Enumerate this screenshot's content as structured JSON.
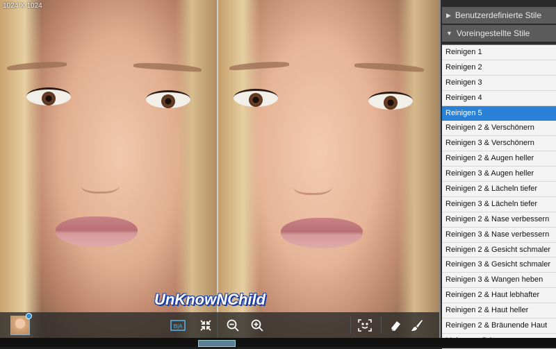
{
  "viewer": {
    "size_label": "1024 X 1024",
    "watermark": "UnKnowNChild"
  },
  "toolbar": {
    "buttons": [
      {
        "name": "before-after-button",
        "icon": "before-after-icon"
      },
      {
        "name": "fit-screen-button",
        "icon": "collapse-arrows-icon"
      },
      {
        "name": "zoom-out-button",
        "icon": "zoom-out-icon"
      },
      {
        "name": "zoom-in-button",
        "icon": "zoom-in-icon"
      },
      {
        "name": "face-detect-button",
        "icon": "smiley-face-icon"
      },
      {
        "name": "eraser-button",
        "icon": "eraser-icon"
      },
      {
        "name": "brush-button",
        "icon": "brush-icon"
      }
    ]
  },
  "panel": {
    "section_custom": "Benutzerdefinierte Stile",
    "section_preset": "Voreingestellte Stile",
    "selected_index": 4,
    "items": [
      "Reinigen 1",
      "Reinigen 2",
      "Reinigen 3",
      "Reinigen 4",
      "Reinigen 5",
      "Reinigen 2 & Verschönern",
      "Reinigen 3 & Verschönern",
      "Reinigen 2 & Augen heller",
      "Reinigen 3 & Augen heller",
      "Reinigen 2 & Lächeln tiefer",
      "Reinigen 3 & Lächeln tiefer",
      "Reinigen 2 & Nase verbessern",
      "Reinigen 3 & Nase verbessern",
      "Reinigen 2 & Gesicht schmaler",
      "Reinigen 3 & Gesicht schmaler",
      "Reinigen 3 & Wangen heben",
      "Reinigen 2 & Haut lebhafter",
      "Reinigen 2 & Haut heller",
      "Reinigen 2 & Bräunende Haut",
      "Make-up - Brise"
    ]
  },
  "colors": {
    "accent": "#2a82d8",
    "panel_header": "#5b5b5b",
    "toolbar_icon": "#ffffff",
    "toolbar_icon_active": "#4fb3e8"
  }
}
